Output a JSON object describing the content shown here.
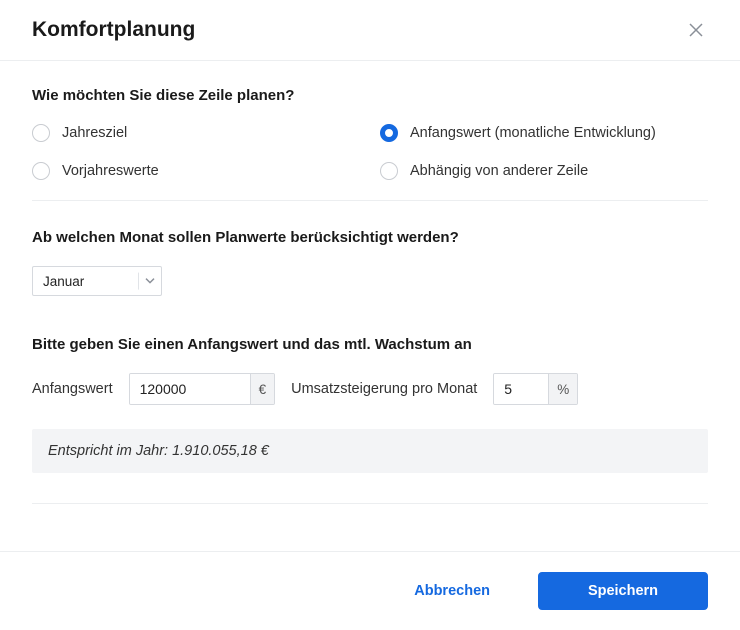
{
  "header": {
    "title": "Komfortplanung"
  },
  "planType": {
    "question": "Wie möchten Sie diese Zeile planen?",
    "options": [
      {
        "key": "jahresziel",
        "label": "Jahresziel",
        "selected": false
      },
      {
        "key": "anfangswert",
        "label": "Anfangswert (monatliche Entwicklung)",
        "selected": true
      },
      {
        "key": "vorjahr",
        "label": "Vorjahreswerte",
        "selected": false
      },
      {
        "key": "abhaengig",
        "label": "Abhängig von anderer Zeile",
        "selected": false
      }
    ]
  },
  "startMonth": {
    "question": "Ab welchen Monat sollen Planwerte berücksichtigt werden?",
    "value": "Januar"
  },
  "startValueSection": {
    "question": "Bitte geben Sie einen Anfangswert und das mtl. Wachstum an",
    "anfangswert": {
      "label": "Anfangswert",
      "value": "120000",
      "unit": "€"
    },
    "steigerung": {
      "label": "Umsatzsteigerung pro Monat",
      "value": "5",
      "unit": "%"
    },
    "calculated": "Entspricht im Jahr: 1.910.055,18 €"
  },
  "footer": {
    "cancel": "Abbrechen",
    "save": "Speichern"
  }
}
